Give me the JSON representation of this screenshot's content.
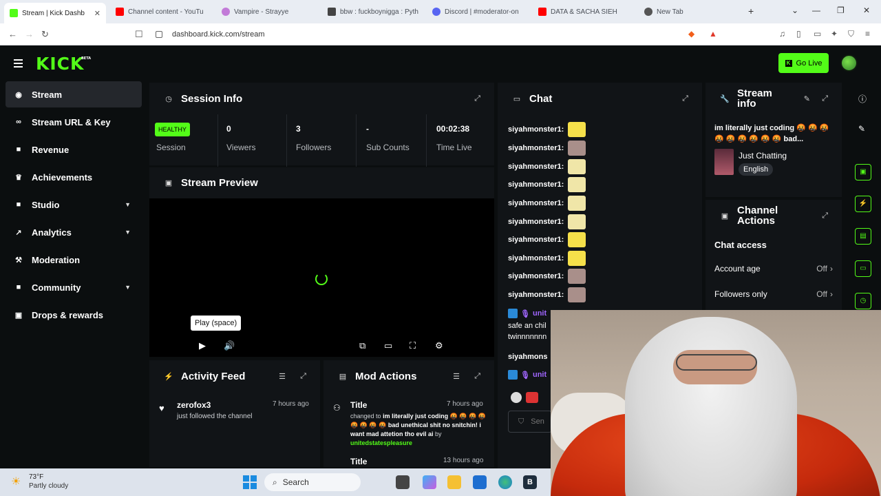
{
  "browser": {
    "tabs": [
      {
        "title": "Stream  |  Kick Dashb",
        "fav_color": "#53fc18",
        "active": true
      },
      {
        "title": "Channel content - YouTu",
        "fav_color": "#ff0000"
      },
      {
        "title": "Vampire - Strayye",
        "fav_color": "#c27bd8"
      },
      {
        "title": "bbw : fuckboynigga : Pyth",
        "fav_color": "#444444"
      },
      {
        "title": "Discord | #moderator-on",
        "fav_color": "#5865f2"
      },
      {
        "title": "DATA & SACHA SIEH",
        "fav_color": "#ff0000"
      },
      {
        "title": "New Tab",
        "fav_color": "#555555"
      }
    ],
    "url": "dashboard.kick.com/stream"
  },
  "header": {
    "logo": "KICK",
    "logo_badge": "BETA",
    "go_live": "Go Live"
  },
  "sidebar": {
    "items": [
      {
        "label": "Stream",
        "icon": "broadcast-icon",
        "glyph": "◉"
      },
      {
        "label": "Stream URL & Key",
        "icon": "link-icon",
        "glyph": "🔗"
      },
      {
        "label": "Revenue",
        "icon": "dollar-icon",
        "glyph": "■"
      },
      {
        "label": "Achievements",
        "icon": "trophy-icon",
        "glyph": "🏆"
      },
      {
        "label": "Studio",
        "icon": "camera-icon",
        "glyph": "■"
      },
      {
        "label": "Analytics",
        "icon": "chart-icon",
        "glyph": "📈"
      },
      {
        "label": "Moderation",
        "icon": "wrench-icon",
        "glyph": "🔧"
      },
      {
        "label": "Community",
        "icon": "community-icon",
        "glyph": "■"
      },
      {
        "label": "Drops & rewards",
        "icon": "gift-icon",
        "glyph": "🎁"
      }
    ]
  },
  "session_info": {
    "title": "Session Info",
    "badge": "HEALTHY",
    "badge_label": "Session",
    "stats": [
      {
        "value": "0",
        "label": "Viewers"
      },
      {
        "value": "3",
        "label": "Followers"
      },
      {
        "value": "-",
        "label": "Sub Counts"
      },
      {
        "value": "00:02:38",
        "label": "Time Live"
      }
    ]
  },
  "preview": {
    "title": "Stream Preview",
    "tooltip": "Play (space)"
  },
  "chat": {
    "title": "Chat",
    "messages": [
      {
        "user": "siyahmonster1:",
        "emote_color": "#f5e04a"
      },
      {
        "user": "siyahmonster1:",
        "emote_color": "#a98f8a"
      },
      {
        "user": "siyahmonster1:",
        "emote_color": "#f0e6a8"
      },
      {
        "user": "siyahmonster1:",
        "emote_color": "#f0e6a8"
      },
      {
        "user": "siyahmonster1:",
        "emote_color": "#f0e6a8"
      },
      {
        "user": "siyahmonster1:",
        "emote_color": "#f0e6a8"
      },
      {
        "user": "siyahmonster1:",
        "emote_color": "#f5e04a"
      },
      {
        "user": "siyahmonster1:",
        "emote_color": "#f5e04a"
      },
      {
        "user": "siyahmonster1:",
        "emote_color": "#a98f8a"
      },
      {
        "user": "siyahmonster1:",
        "emote_color": "#a98f8a"
      }
    ],
    "partial_user": "unit",
    "partial_text_1": "safe an chil",
    "partial_text_2": "twinnnnnnn",
    "partial_user_2": "siyahmons",
    "partial_user_3": "unit",
    "input_placeholder": "Sen"
  },
  "stream_info": {
    "title": "Stream info",
    "stream_title": "im literally just coding 🤬 🤬 🤬 🤬 🤬 🤬 🤬 🤬 🤬 bad...",
    "category": "Just Chatting",
    "language": "English"
  },
  "channel_actions": {
    "title": "Channel Actions",
    "section": "Chat access",
    "rows": [
      {
        "label": "Account age",
        "value": "Off"
      },
      {
        "label": "Followers only",
        "value": "Off"
      }
    ]
  },
  "activity_feed": {
    "title": "Activity Feed",
    "items": [
      {
        "user": "zerofox3",
        "action": "just followed the channel",
        "time": "7 hours ago"
      }
    ]
  },
  "mod_actions": {
    "title": "Mod Actions",
    "items": [
      {
        "title": "Title",
        "time": "7 hours ago",
        "changed_to": "changed to",
        "text": "im literally just coding 🤬 🤬 🤬 🤬 🤬 🤬 🤬 🤬 bad unethical shit no snitchin! i want mad attetion tho evil ai",
        "by": "by",
        "by_user": "unitedstatespleasure"
      },
      {
        "title": "Title",
        "time": "13 hours ago"
      }
    ]
  },
  "taskbar": {
    "weather_temp": "73°F",
    "weather_desc": "Partly cloudy",
    "search": "Search"
  },
  "colors": {
    "accent": "#53fc18",
    "panel": "#111417",
    "bg": "#0b0e0f"
  }
}
